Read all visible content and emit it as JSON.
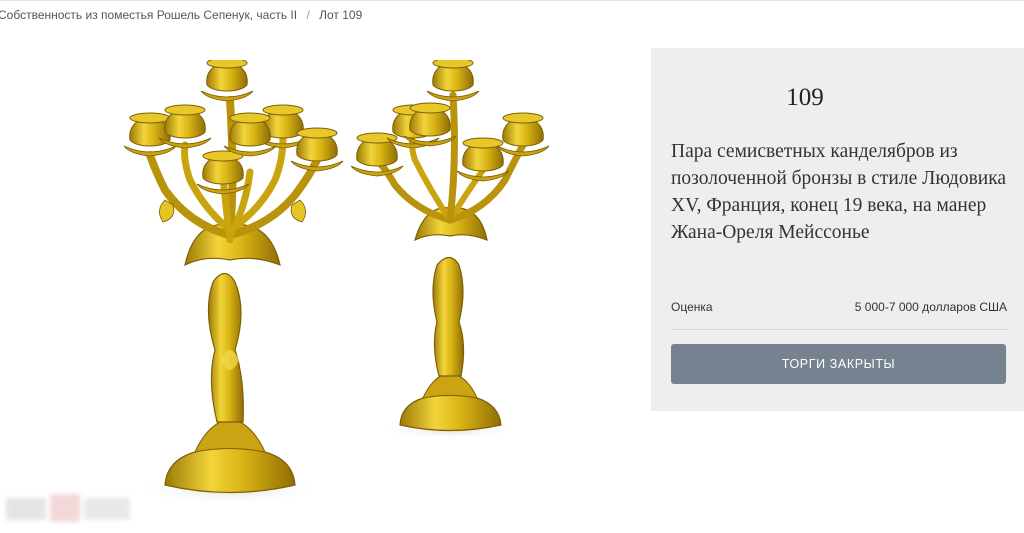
{
  "breadcrumb": {
    "items": [
      {
        "label": "Собственность из поместья Рошель Сепенук, часть II"
      },
      {
        "label": "Лот 109"
      }
    ],
    "separator": "/"
  },
  "lot": {
    "number": "109",
    "title": "Пара семисветных канделябров из позолоченной бронзы в стиле Людовика XV, Франция, конец 19 века, на манер Жана-Ореля Мейссонье",
    "estimate_label": "Оценка",
    "estimate_value": "5 000-7 000 долларов США",
    "status_button": "ТОРГИ ЗАКРЫТЫ"
  },
  "colors": {
    "panel_bg": "#eeeeee",
    "button_bg": "#768290",
    "gilt": "#d9b414"
  }
}
